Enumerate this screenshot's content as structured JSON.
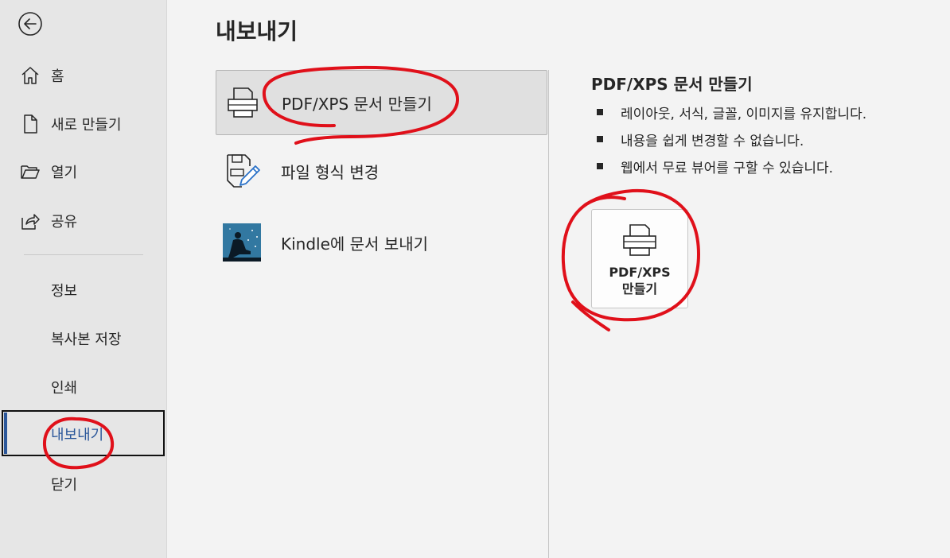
{
  "sidebar": {
    "back_icon": "back-arrow-icon",
    "items": [
      {
        "label": "홈",
        "icon": "home-icon"
      },
      {
        "label": "새로 만들기",
        "icon": "new-document-icon"
      },
      {
        "label": "열기",
        "icon": "open-folder-icon"
      },
      {
        "label": "공유",
        "icon": "share-icon"
      }
    ],
    "sub_items": [
      "정보",
      "복사본 저장",
      "인쇄",
      "내보내기",
      "닫기"
    ],
    "active": "내보내기"
  },
  "main": {
    "title": "내보내기",
    "options": [
      {
        "label": "PDF/XPS 문서 만들기",
        "icon": "pdf-xps-icon",
        "selected": true
      },
      {
        "label": "파일 형식 변경",
        "icon": "change-file-type-icon",
        "selected": false
      },
      {
        "label": "Kindle에 문서 보내기",
        "icon": "kindle-icon",
        "selected": false
      }
    ]
  },
  "detail": {
    "title": "PDF/XPS 문서 만들기",
    "bullets": [
      "레이아웃, 서식, 글꼴, 이미지를 유지합니다.",
      "내용을 쉽게 변경할 수 없습니다.",
      "웹에서 무료 뷰어를 구할 수 있습니다."
    ],
    "button": {
      "line1": "PDF/XPS",
      "line2": "만들기",
      "icon": "pdf-xps-icon"
    }
  },
  "colors": {
    "accent": "#2b579a",
    "annotation": "#e0101a",
    "sidebar_bg": "#e6e6e6",
    "main_bg": "#f3f3f3"
  }
}
